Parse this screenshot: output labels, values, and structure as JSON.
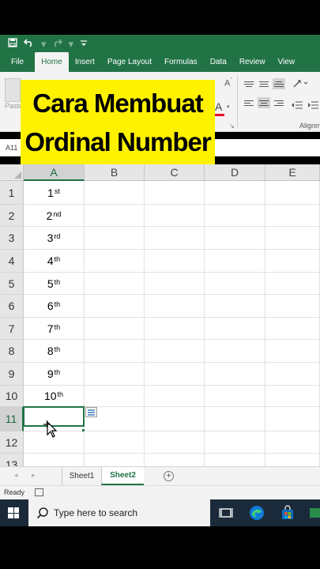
{
  "qat": {
    "save_icon": "save-icon",
    "undo_icon": "undo-icon",
    "redo_icon": "redo-icon",
    "customize_icon": "customize-icon"
  },
  "tabs": [
    "File",
    "Home",
    "Insert",
    "Page Layout",
    "Formulas",
    "Data",
    "Review",
    "View"
  ],
  "active_tab": "Home",
  "ribbon": {
    "paste_label": "Paste",
    "alignment_label": "Alignm"
  },
  "overlay": {
    "line1": "Cara Membuat",
    "line2": "Ordinal Number"
  },
  "formula_bar": {
    "name_box": "A11"
  },
  "columns": [
    "A",
    "B",
    "C",
    "D",
    "E"
  ],
  "rows": [
    "1",
    "2",
    "3",
    "4",
    "5",
    "6",
    "7",
    "8",
    "9",
    "10",
    "11",
    "12",
    "13"
  ],
  "cells": [
    {
      "num": "1",
      "suffix": "st"
    },
    {
      "num": "2",
      "suffix": "nd"
    },
    {
      "num": "3",
      "suffix": "rd"
    },
    {
      "num": "4",
      "suffix": "th"
    },
    {
      "num": "5",
      "suffix": "th"
    },
    {
      "num": "6",
      "suffix": "th"
    },
    {
      "num": "7",
      "suffix": "th"
    },
    {
      "num": "8",
      "suffix": "th"
    },
    {
      "num": "9",
      "suffix": "th"
    },
    {
      "num": "10",
      "suffix": "th"
    }
  ],
  "active_cell": "A11",
  "sheets": [
    "Sheet1",
    "Sheet2"
  ],
  "active_sheet": "Sheet2",
  "status": {
    "text": "Ready"
  },
  "taskbar": {
    "search_placeholder": "Type here to search"
  },
  "colors": {
    "excel_green": "#217346",
    "banner_yellow": "#fff200",
    "taskbar": "#1b2a3a"
  }
}
